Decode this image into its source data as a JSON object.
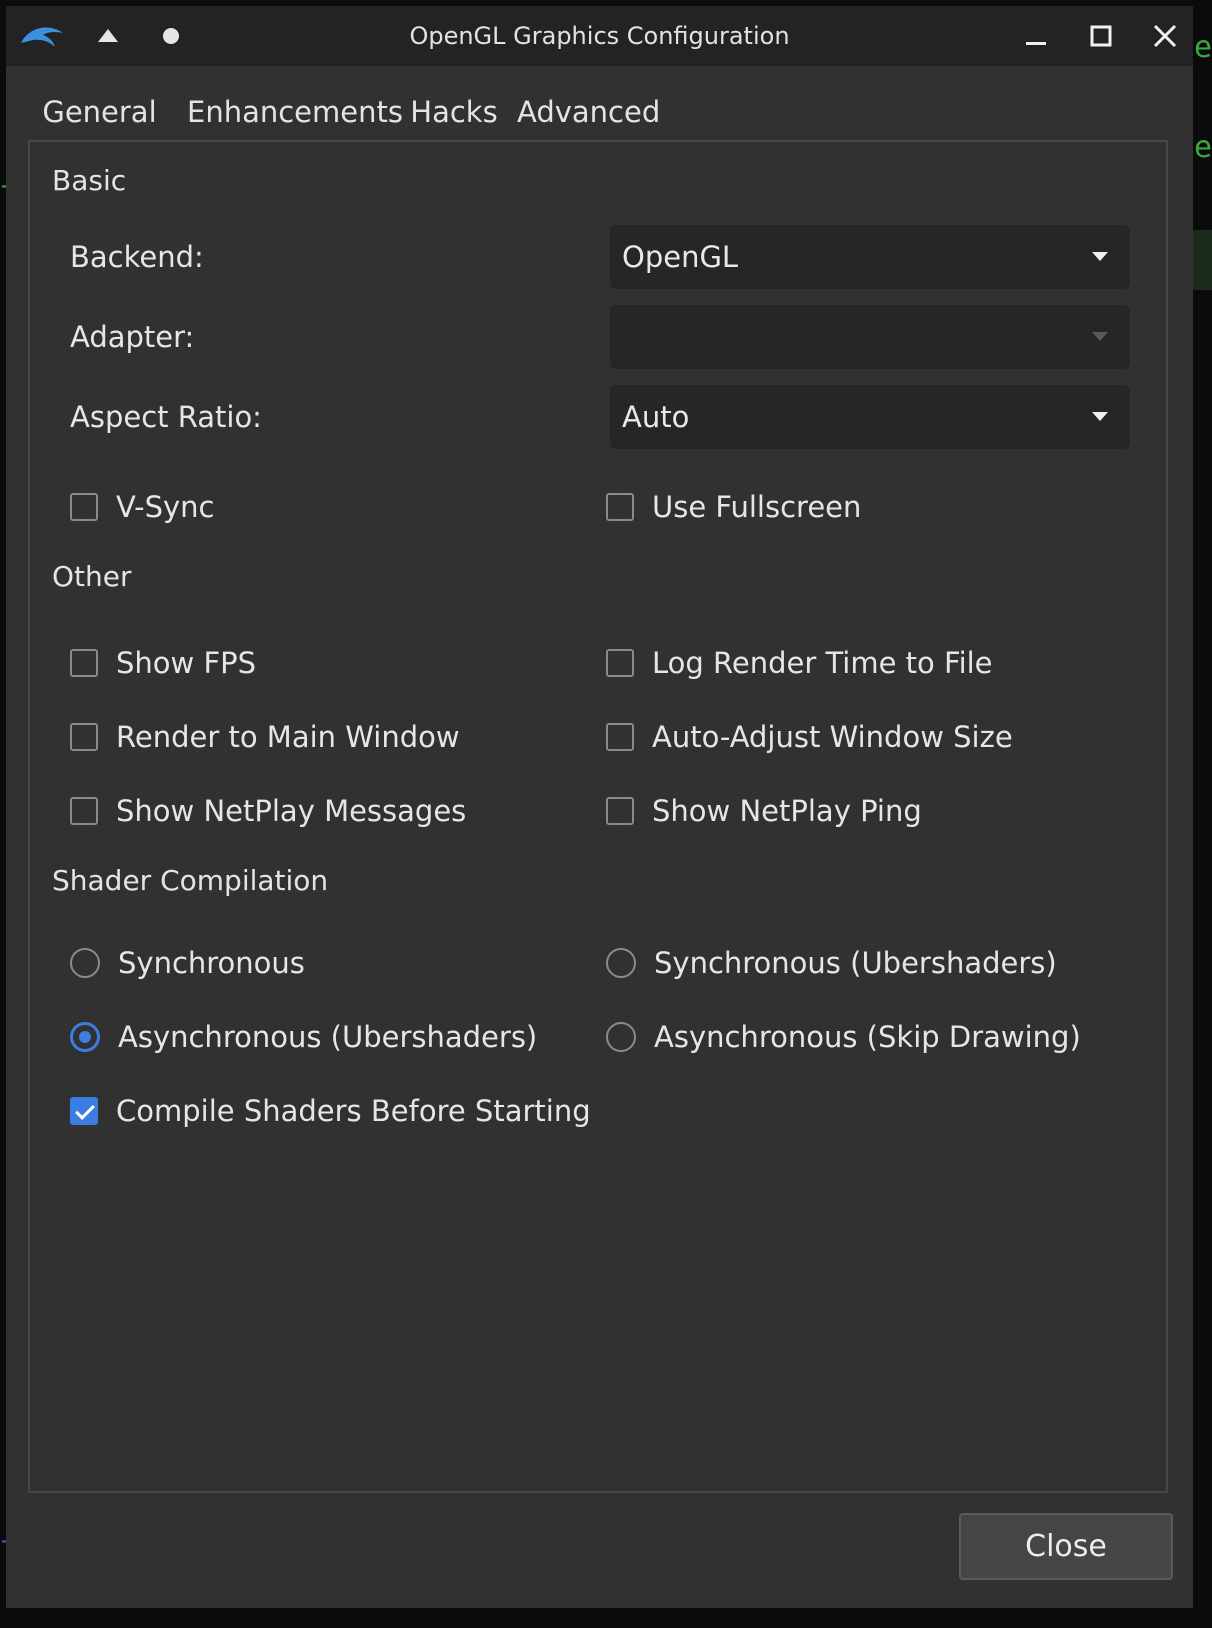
{
  "window": {
    "title": "OpenGL Graphics Configuration",
    "accent_color": "#3b7de2"
  },
  "titlebar_icons": [
    "dolphin-logo-icon",
    "keep-above-icon",
    "sticky-dot-icon",
    "minimize-icon",
    "maximize-icon",
    "close-icon"
  ],
  "tabs": [
    {
      "label": "General",
      "active": true
    },
    {
      "label": "Enhancements",
      "active": false
    },
    {
      "label": "Hacks",
      "active": false
    },
    {
      "label": "Advanced",
      "active": false
    }
  ],
  "basic": {
    "title": "Basic",
    "backend_label": "Backend:",
    "backend_value": "OpenGL",
    "adapter_label": "Adapter:",
    "adapter_value": "",
    "aspect_label": "Aspect Ratio:",
    "aspect_value": "Auto",
    "vsync_label": "V-Sync",
    "vsync_checked": false,
    "fullscreen_label": "Use Fullscreen",
    "fullscreen_checked": false
  },
  "other": {
    "title": "Other",
    "show_fps": "Show FPS",
    "log_render_time": "Log Render Time to File",
    "render_main_window": "Render to Main Window",
    "auto_adjust": "Auto-Adjust Window Size",
    "show_netplay_messages": "Show NetPlay Messages",
    "show_netplay_ping": "Show NetPlay Ping"
  },
  "shader": {
    "title": "Shader Compilation",
    "synchronous": "Synchronous",
    "sync_ubershaders": "Synchronous (Ubershaders)",
    "async_ubershaders": "Asynchronous (Ubershaders)",
    "async_skip": "Asynchronous (Skip Drawing)",
    "selected": "Asynchronous (Ubershaders)",
    "compile_before": "Compile Shaders Before Starting",
    "compile_before_checked": true
  },
  "footer": {
    "close_label": "Close"
  }
}
